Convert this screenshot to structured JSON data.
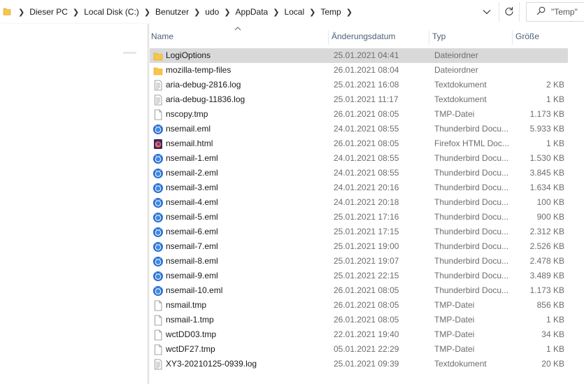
{
  "breadcrumb": [
    "Dieser PC",
    "Local Disk (C:)",
    "Benutzer",
    "udo",
    "AppData",
    "Local",
    "Temp"
  ],
  "search": {
    "placeholder": "\"Temp\" durchsuchen",
    "shown_text": "\"Temp\""
  },
  "columns": {
    "name": "Name",
    "date": "Änderungsdatum",
    "type": "Typ",
    "size": "Größe"
  },
  "files": [
    {
      "name": "LogiOptions",
      "date": "25.01.2021 04:41",
      "type": "Dateiordner",
      "size": "",
      "icon": "folder-icon",
      "selected": true
    },
    {
      "name": "mozilla-temp-files",
      "date": "26.01.2021 08:04",
      "type": "Dateiordner",
      "size": "",
      "icon": "folder-icon"
    },
    {
      "name": "aria-debug-2816.log",
      "date": "25.01.2021 16:08",
      "type": "Textdokument",
      "size": "2 KB",
      "icon": "text-file-icon"
    },
    {
      "name": "aria-debug-11836.log",
      "date": "25.01.2021 11:17",
      "type": "Textdokument",
      "size": "1 KB",
      "icon": "text-file-icon"
    },
    {
      "name": "nscopy.tmp",
      "date": "26.01.2021 08:05",
      "type": "TMP-Datei",
      "size": "1.173 KB",
      "icon": "blank-file-icon"
    },
    {
      "name": "nsemail.eml",
      "date": "24.01.2021 08:55",
      "type": "Thunderbird Docu...",
      "size": "5.933 KB",
      "icon": "thunderbird-icon"
    },
    {
      "name": "nsemail.html",
      "date": "26.01.2021 08:05",
      "type": "Firefox HTML Doc...",
      "size": "1 KB",
      "icon": "firefox-html-icon"
    },
    {
      "name": "nsemail-1.eml",
      "date": "24.01.2021 08:55",
      "type": "Thunderbird Docu...",
      "size": "1.530 KB",
      "icon": "thunderbird-icon"
    },
    {
      "name": "nsemail-2.eml",
      "date": "24.01.2021 08:55",
      "type": "Thunderbird Docu...",
      "size": "3.845 KB",
      "icon": "thunderbird-icon"
    },
    {
      "name": "nsemail-3.eml",
      "date": "24.01.2021 20:16",
      "type": "Thunderbird Docu...",
      "size": "1.634 KB",
      "icon": "thunderbird-icon"
    },
    {
      "name": "nsemail-4.eml",
      "date": "24.01.2021 20:18",
      "type": "Thunderbird Docu...",
      "size": "100 KB",
      "icon": "thunderbird-icon"
    },
    {
      "name": "nsemail-5.eml",
      "date": "25.01.2021 17:16",
      "type": "Thunderbird Docu...",
      "size": "900 KB",
      "icon": "thunderbird-icon"
    },
    {
      "name": "nsemail-6.eml",
      "date": "25.01.2021 17:15",
      "type": "Thunderbird Docu...",
      "size": "2.312 KB",
      "icon": "thunderbird-icon"
    },
    {
      "name": "nsemail-7.eml",
      "date": "25.01.2021 19:00",
      "type": "Thunderbird Docu...",
      "size": "2.526 KB",
      "icon": "thunderbird-icon"
    },
    {
      "name": "nsemail-8.eml",
      "date": "25.01.2021 19:07",
      "type": "Thunderbird Docu...",
      "size": "2.478 KB",
      "icon": "thunderbird-icon"
    },
    {
      "name": "nsemail-9.eml",
      "date": "25.01.2021 22:15",
      "type": "Thunderbird Docu...",
      "size": "3.489 KB",
      "icon": "thunderbird-icon"
    },
    {
      "name": "nsemail-10.eml",
      "date": "26.01.2021 08:05",
      "type": "Thunderbird Docu...",
      "size": "1.173 KB",
      "icon": "thunderbird-icon"
    },
    {
      "name": "nsmail.tmp",
      "date": "26.01.2021 08:05",
      "type": "TMP-Datei",
      "size": "856 KB",
      "icon": "blank-file-icon"
    },
    {
      "name": "nsmail-1.tmp",
      "date": "26.01.2021 08:05",
      "type": "TMP-Datei",
      "size": "1 KB",
      "icon": "blank-file-icon"
    },
    {
      "name": "wctDD03.tmp",
      "date": "22.01.2021 19:40",
      "type": "TMP-Datei",
      "size": "34 KB",
      "icon": "blank-file-icon"
    },
    {
      "name": "wctDF27.tmp",
      "date": "05.01.2021 22:29",
      "type": "TMP-Datei",
      "size": "1 KB",
      "icon": "blank-file-icon"
    },
    {
      "name": "XY3-20210125-0939.log",
      "date": "25.01.2021 09:39",
      "type": "Textdokument",
      "size": "20 KB",
      "icon": "text-file-icon"
    }
  ],
  "colors": {
    "folder": "#f8c646",
    "selection": "#d9d9d9",
    "header_text": "#4c607a",
    "thunderbird": "#2a6fd1"
  }
}
